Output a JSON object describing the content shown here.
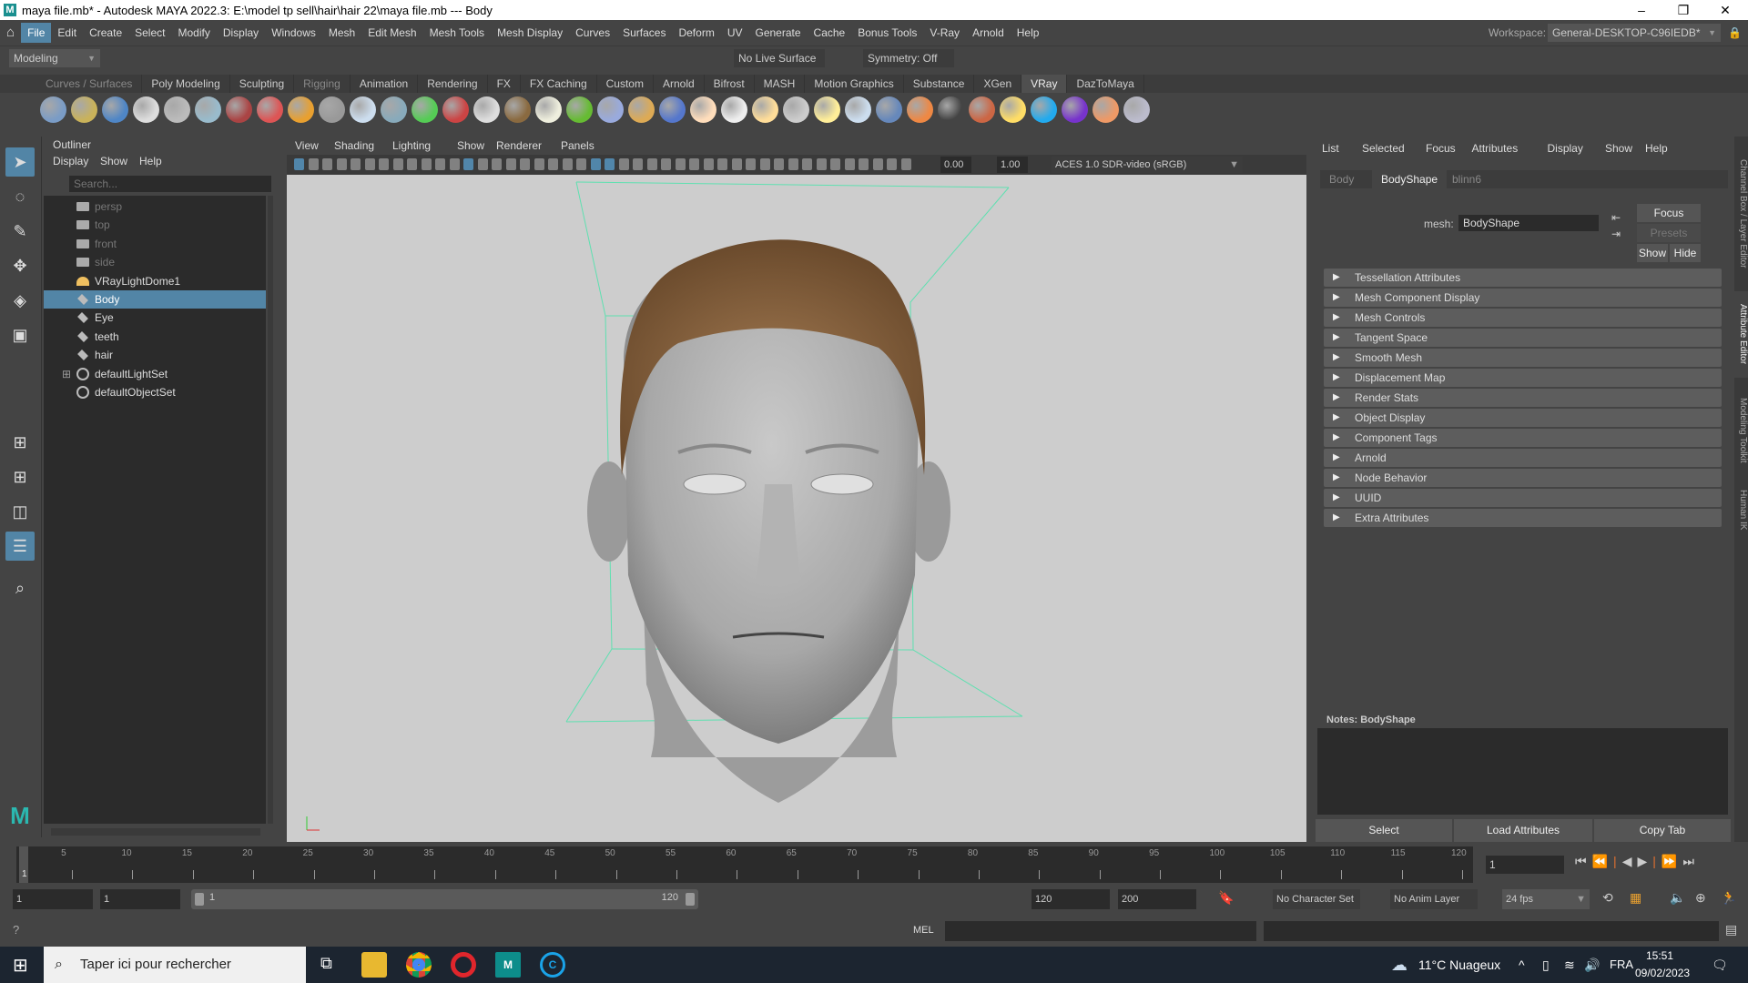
{
  "window": {
    "title": "maya file.mb* - Autodesk MAYA 2022.3: E:\\model tp sell\\hair\\hair 22\\maya file.mb  ---  Body",
    "minimize": "–",
    "maximize": "❐",
    "close": "✕"
  },
  "menubar": {
    "items": [
      "File",
      "Edit",
      "Create",
      "Select",
      "Modify",
      "Display",
      "Windows",
      "Mesh",
      "Edit Mesh",
      "Mesh Tools",
      "Mesh Display",
      "Curves",
      "Surfaces",
      "Deform",
      "UV",
      "Generate",
      "Cache",
      "Bonus Tools",
      "V-Ray",
      "Arnold",
      "Help"
    ],
    "workspace_label": "Workspace:",
    "workspace_value": "General-DESKTOP-C96IEDB*"
  },
  "statusline": {
    "mode": "Modeling",
    "live_surface": "No Live Surface",
    "symmetry": "Symmetry: Off"
  },
  "shelf": {
    "tabs": [
      "Curves / Surfaces",
      "Poly Modeling",
      "Sculpting",
      "Rigging",
      "Animation",
      "Rendering",
      "FX",
      "FX Caching",
      "Custom",
      "Arnold",
      "Bifrost",
      "MASH",
      "Motion Graphics",
      "Substance",
      "XGen",
      "VRay",
      "DazToMaya"
    ],
    "active_tab": "VRay",
    "icon_colors": [
      "#7a9cc6",
      "#c9b25a",
      "#4f86c6",
      "#ddd",
      "#bbb",
      "#9bc",
      "#a44",
      "#d55",
      "#e8a030",
      "#999",
      "#cde",
      "#8ab",
      "#5c5",
      "#c44",
      "#ddd",
      "#8a6a40",
      "#eed",
      "#6b3",
      "#9ad",
      "#da5",
      "#57c",
      "#fdb",
      "#eee",
      "#fd9",
      "#ccc",
      "#fe9",
      "#cde",
      "#68b",
      "#e84",
      "#444",
      "#c64",
      "#fd6",
      "#2ae",
      "#73c",
      "#e96",
      "#bbc"
    ]
  },
  "outliner": {
    "title": "Outliner",
    "menus": [
      "Display",
      "Show",
      "Help"
    ],
    "search_placeholder": "Search...",
    "items": [
      {
        "label": "persp",
        "icon": "camera-icon",
        "dim": true
      },
      {
        "label": "top",
        "icon": "camera-icon",
        "dim": true
      },
      {
        "label": "front",
        "icon": "camera-icon",
        "dim": true
      },
      {
        "label": "side",
        "icon": "camera-icon",
        "dim": true
      },
      {
        "label": "VRayLightDome1",
        "icon": "dome-light-icon"
      },
      {
        "label": "Body",
        "icon": "mesh-icon",
        "selected": true
      },
      {
        "label": "Eye",
        "icon": "mesh-icon"
      },
      {
        "label": "teeth",
        "icon": "mesh-icon"
      },
      {
        "label": "hair",
        "icon": "mesh-icon"
      },
      {
        "label": "defaultLightSet",
        "icon": "set-icon",
        "expandable": true
      },
      {
        "label": "defaultObjectSet",
        "icon": "set-icon"
      }
    ]
  },
  "viewport": {
    "menus": [
      "View",
      "Shading",
      "Lighting",
      "Show",
      "Renderer",
      "Panels"
    ],
    "exposure": "0.00",
    "gamma": "1.00",
    "color_space": "ACES 1.0 SDR-video (sRGB)",
    "bbox_color": "#5ee0b0"
  },
  "attribute_editor": {
    "menus": [
      "List",
      "Selected",
      "Focus",
      "Attributes",
      "Display",
      "Show",
      "Help"
    ],
    "tabs": [
      "Body",
      "BodyShape",
      "blinn6"
    ],
    "active_tab": "BodyShape",
    "mesh_label": "mesh:",
    "mesh_value": "BodyShape",
    "focus": "Focus",
    "presets": "Presets",
    "show": "Show",
    "hide": "Hide",
    "sections": [
      "Tessellation Attributes",
      "Mesh Component Display",
      "Mesh Controls",
      "Tangent Space",
      "Smooth Mesh",
      "Displacement Map",
      "Render Stats",
      "Object Display",
      "Component Tags",
      "Arnold",
      "Node Behavior",
      "UUID",
      "Extra Attributes"
    ],
    "notes_label": "Notes:  BodyShape",
    "buttons": [
      "Select",
      "Load Attributes",
      "Copy Tab"
    ]
  },
  "side_tabs": [
    "Channel Box / Layer Editor",
    "Attribute Editor",
    "Modeling Toolkit",
    "Human IK"
  ],
  "timeline": {
    "start": 1,
    "end": 120,
    "step": 5,
    "current": 1,
    "current_frame_field": "1"
  },
  "range": {
    "start_field": "1",
    "playback_start": "1",
    "slider_start": "1",
    "slider_end": "120",
    "playback_end": "120",
    "end_field": "200",
    "character_set": "No Character Set",
    "anim_layer": "No Anim Layer",
    "fps": "24 fps"
  },
  "command_line": {
    "lang": "MEL"
  },
  "taskbar": {
    "search_placeholder": "Taper ici pour rechercher",
    "weather": "11°C  Nuageux",
    "language": "FRA",
    "time": "15:51",
    "date": "09/02/2023"
  }
}
